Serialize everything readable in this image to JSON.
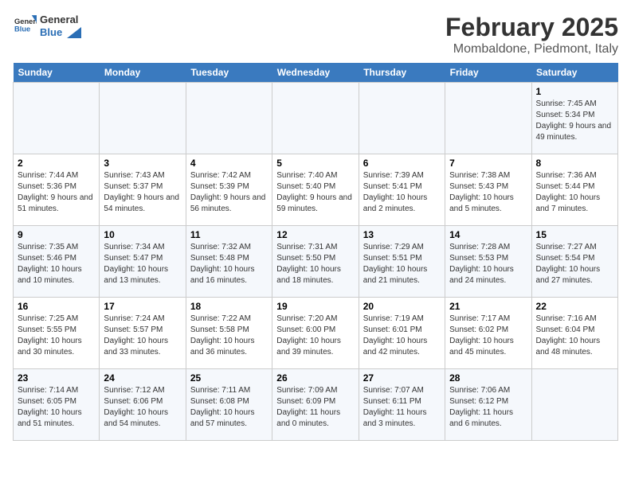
{
  "header": {
    "logo_general": "General",
    "logo_blue": "Blue",
    "month": "February 2025",
    "location": "Mombaldone, Piedmont, Italy"
  },
  "days_of_week": [
    "Sunday",
    "Monday",
    "Tuesday",
    "Wednesday",
    "Thursday",
    "Friday",
    "Saturday"
  ],
  "weeks": [
    [
      {
        "day": "",
        "info": ""
      },
      {
        "day": "",
        "info": ""
      },
      {
        "day": "",
        "info": ""
      },
      {
        "day": "",
        "info": ""
      },
      {
        "day": "",
        "info": ""
      },
      {
        "day": "",
        "info": ""
      },
      {
        "day": "1",
        "info": "Sunrise: 7:45 AM\nSunset: 5:34 PM\nDaylight: 9 hours and 49 minutes."
      }
    ],
    [
      {
        "day": "2",
        "info": "Sunrise: 7:44 AM\nSunset: 5:36 PM\nDaylight: 9 hours and 51 minutes."
      },
      {
        "day": "3",
        "info": "Sunrise: 7:43 AM\nSunset: 5:37 PM\nDaylight: 9 hours and 54 minutes."
      },
      {
        "day": "4",
        "info": "Sunrise: 7:42 AM\nSunset: 5:39 PM\nDaylight: 9 hours and 56 minutes."
      },
      {
        "day": "5",
        "info": "Sunrise: 7:40 AM\nSunset: 5:40 PM\nDaylight: 9 hours and 59 minutes."
      },
      {
        "day": "6",
        "info": "Sunrise: 7:39 AM\nSunset: 5:41 PM\nDaylight: 10 hours and 2 minutes."
      },
      {
        "day": "7",
        "info": "Sunrise: 7:38 AM\nSunset: 5:43 PM\nDaylight: 10 hours and 5 minutes."
      },
      {
        "day": "8",
        "info": "Sunrise: 7:36 AM\nSunset: 5:44 PM\nDaylight: 10 hours and 7 minutes."
      }
    ],
    [
      {
        "day": "9",
        "info": "Sunrise: 7:35 AM\nSunset: 5:46 PM\nDaylight: 10 hours and 10 minutes."
      },
      {
        "day": "10",
        "info": "Sunrise: 7:34 AM\nSunset: 5:47 PM\nDaylight: 10 hours and 13 minutes."
      },
      {
        "day": "11",
        "info": "Sunrise: 7:32 AM\nSunset: 5:48 PM\nDaylight: 10 hours and 16 minutes."
      },
      {
        "day": "12",
        "info": "Sunrise: 7:31 AM\nSunset: 5:50 PM\nDaylight: 10 hours and 18 minutes."
      },
      {
        "day": "13",
        "info": "Sunrise: 7:29 AM\nSunset: 5:51 PM\nDaylight: 10 hours and 21 minutes."
      },
      {
        "day": "14",
        "info": "Sunrise: 7:28 AM\nSunset: 5:53 PM\nDaylight: 10 hours and 24 minutes."
      },
      {
        "day": "15",
        "info": "Sunrise: 7:27 AM\nSunset: 5:54 PM\nDaylight: 10 hours and 27 minutes."
      }
    ],
    [
      {
        "day": "16",
        "info": "Sunrise: 7:25 AM\nSunset: 5:55 PM\nDaylight: 10 hours and 30 minutes."
      },
      {
        "day": "17",
        "info": "Sunrise: 7:24 AM\nSunset: 5:57 PM\nDaylight: 10 hours and 33 minutes."
      },
      {
        "day": "18",
        "info": "Sunrise: 7:22 AM\nSunset: 5:58 PM\nDaylight: 10 hours and 36 minutes."
      },
      {
        "day": "19",
        "info": "Sunrise: 7:20 AM\nSunset: 6:00 PM\nDaylight: 10 hours and 39 minutes."
      },
      {
        "day": "20",
        "info": "Sunrise: 7:19 AM\nSunset: 6:01 PM\nDaylight: 10 hours and 42 minutes."
      },
      {
        "day": "21",
        "info": "Sunrise: 7:17 AM\nSunset: 6:02 PM\nDaylight: 10 hours and 45 minutes."
      },
      {
        "day": "22",
        "info": "Sunrise: 7:16 AM\nSunset: 6:04 PM\nDaylight: 10 hours and 48 minutes."
      }
    ],
    [
      {
        "day": "23",
        "info": "Sunrise: 7:14 AM\nSunset: 6:05 PM\nDaylight: 10 hours and 51 minutes."
      },
      {
        "day": "24",
        "info": "Sunrise: 7:12 AM\nSunset: 6:06 PM\nDaylight: 10 hours and 54 minutes."
      },
      {
        "day": "25",
        "info": "Sunrise: 7:11 AM\nSunset: 6:08 PM\nDaylight: 10 hours and 57 minutes."
      },
      {
        "day": "26",
        "info": "Sunrise: 7:09 AM\nSunset: 6:09 PM\nDaylight: 11 hours and 0 minutes."
      },
      {
        "day": "27",
        "info": "Sunrise: 7:07 AM\nSunset: 6:11 PM\nDaylight: 11 hours and 3 minutes."
      },
      {
        "day": "28",
        "info": "Sunrise: 7:06 AM\nSunset: 6:12 PM\nDaylight: 11 hours and 6 minutes."
      },
      {
        "day": "",
        "info": ""
      }
    ]
  ]
}
